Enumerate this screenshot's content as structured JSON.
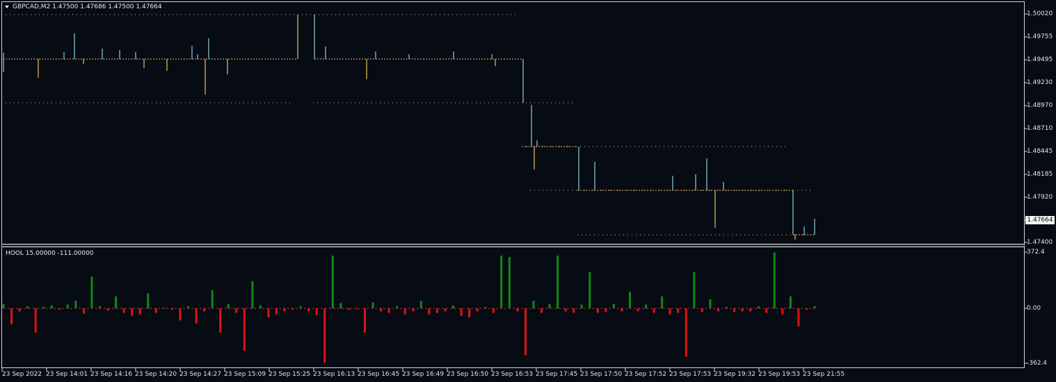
{
  "main_chart": {
    "symbol_title": "GBPCAD,M2  1.47500 1.47686 1.47500 1.47664",
    "price_ticks": [
      "1.50020",
      "1.49755",
      "1.49495",
      "1.49230",
      "1.48970",
      "1.48710",
      "1.48445",
      "1.48185",
      "1.47920",
      "1.47664",
      "1.47400"
    ],
    "current_price": "1.47664",
    "colors": {
      "background": "#070b14",
      "up": "#8fd0dc",
      "down": "#f0c05a",
      "grid_dots": "#d4cf8d"
    }
  },
  "indicator": {
    "title": "HOOL 15.00000 -111.00000",
    "ticks": [
      "372.4",
      "0.00",
      "-362.4"
    ],
    "colors": {
      "positive": "#0f8a12",
      "negative": "#e01313"
    }
  },
  "time_axis": {
    "labels": [
      "23 Sep 2022",
      "23 Sep 14:01",
      "23 Sep 14:16",
      "23 Sep 14:20",
      "23 Sep 14:27",
      "23 Sep 15:09",
      "23 Sep 15:25",
      "23 Sep 16:13",
      "23 Sep 16:45",
      "23 Sep 16:49",
      "23 Sep 16:50",
      "23 Sep 16:53",
      "23 Sep 17:45",
      "23 Sep 17:50",
      "23 Sep 17:52",
      "23 Sep 17:53",
      "23 Sep 19:32",
      "23 Sep 19:53",
      "23 Sep 21:55"
    ]
  },
  "chart_data": {
    "type": "bar",
    "title": "",
    "ylabel": "",
    "ylim": [
      -362.4,
      372.4
    ],
    "series": [
      {
        "name": "HOOL",
        "values": [
          30,
          -105,
          -20,
          15,
          -160,
          10,
          20,
          -10,
          25,
          50,
          -35,
          210,
          15,
          -15,
          80,
          -30,
          -50,
          -40,
          100,
          -30,
          5,
          -10,
          -80,
          15,
          -100,
          -20,
          120,
          -160,
          30,
          -30,
          -280,
          180,
          20,
          -60,
          -40,
          -20,
          -10,
          15,
          -20,
          -45,
          -360,
          350,
          35,
          -10,
          -5,
          -160,
          40,
          -20,
          -30,
          15,
          -40,
          -20,
          50,
          -40,
          -30,
          -20,
          20,
          -50,
          -60,
          -20,
          10,
          -30,
          350,
          340,
          -20,
          -310,
          50,
          -30,
          30,
          350,
          -20,
          -30,
          25,
          240,
          -30,
          -25,
          30,
          -20,
          110,
          -20,
          25,
          -30,
          80,
          -40,
          -30,
          -320,
          240,
          -25,
          60,
          -20,
          10,
          -25,
          -20,
          -20,
          15,
          -30,
          370,
          -40,
          80,
          -120,
          -10,
          15
        ]
      }
    ]
  }
}
